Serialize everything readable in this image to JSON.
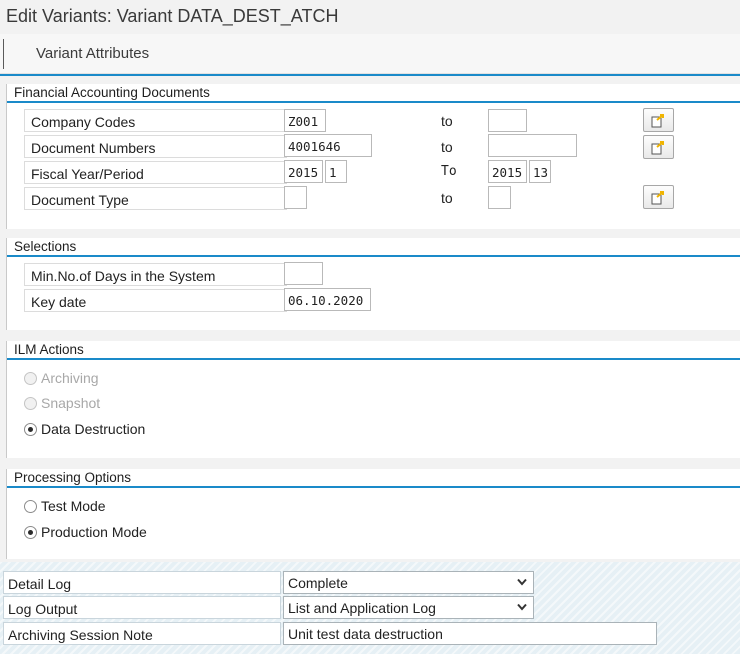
{
  "window": {
    "title": "Edit Variants: Variant DATA_DEST_ATCH"
  },
  "tabs": {
    "variant_attributes": "Variant Attributes"
  },
  "fin_docs": {
    "title": "Financial Accounting Documents",
    "company_codes": {
      "label": "Company Codes",
      "from": "Z001",
      "to_label": "to",
      "to": ""
    },
    "document_numbers": {
      "label": "Document Numbers",
      "from": "4001646",
      "to_label": "to",
      "to": ""
    },
    "fiscal_period": {
      "label": "Fiscal Year/Period",
      "year_from": "2015",
      "period_from": "1",
      "to_label": "To",
      "year_to": "2015",
      "period_to": "13"
    },
    "document_type": {
      "label": "Document Type",
      "from": "",
      "to_label": "to",
      "to": ""
    }
  },
  "selections": {
    "title": "Selections",
    "min_days": {
      "label": "Min.No.of Days in the System",
      "value": ""
    },
    "key_date": {
      "label": "Key date",
      "value": "06.10.2020"
    }
  },
  "ilm": {
    "title": "ILM Actions",
    "archiving": "Archiving",
    "snapshot": "Snapshot",
    "data_destruction": "Data Destruction",
    "selected": "data_destruction"
  },
  "processing": {
    "title": "Processing Options",
    "test_mode": "Test Mode",
    "production_mode": "Production Mode",
    "selected": "production_mode"
  },
  "bottom": {
    "detail_log": {
      "label": "Detail Log",
      "value": "Complete"
    },
    "log_output": {
      "label": "Log Output",
      "value": "List and Application Log"
    },
    "session_note": {
      "label": "Archiving Session Note",
      "value": "Unit test data destruction"
    }
  },
  "colors": {
    "accent": "#1a8ac9",
    "multi_arrow": "#f0b400"
  }
}
